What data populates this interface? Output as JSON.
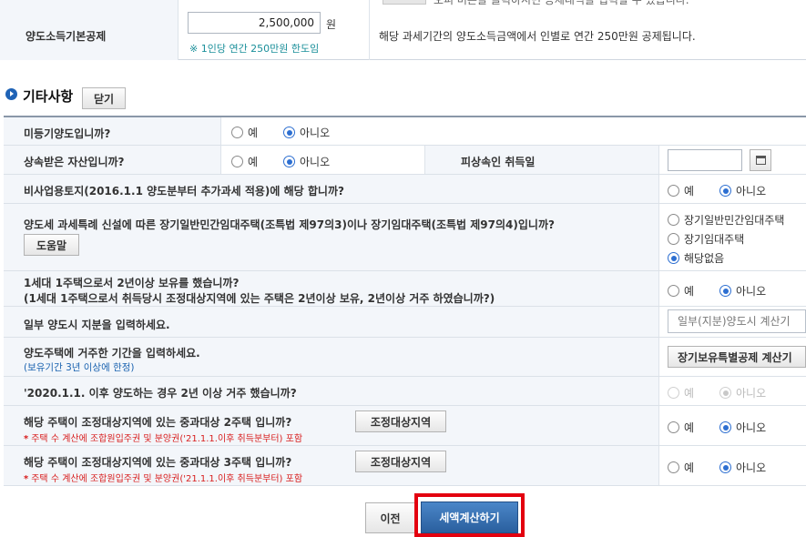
{
  "top_section": {
    "label": "양도소득기본공제",
    "amount_value": "2,500,000",
    "unit": "원",
    "limit_note": "※ 1인당 연간 250만원 한도임",
    "description": "해당 과세기간의 양도소득금액에서 인별로 연간 250만원 공제됩니다.",
    "cut_off_text": "오피 버튼을 클릭하시면 공제내역을 입력할 수 있습니다."
  },
  "section": {
    "title": "기타사항",
    "close_label": "닫기"
  },
  "rows": {
    "unregistered": {
      "question": "미등기양도입니까?",
      "yes": "예",
      "no": "아니오"
    },
    "inherited": {
      "question": "상속받은 자산입니까?",
      "yes": "예",
      "no": "아니오",
      "decedent_label": "피상속인 취득일"
    },
    "non_business_land": {
      "question": "비사업용토지(2016.1.1 양도분부터 추가과세 적용)에 해당 합니까?",
      "yes": "예",
      "no": "아니오"
    },
    "long_term_rental": {
      "question": "양도세 과세특례 신설에 따른 장기일반민간임대주택(조특법 제97의3)이나 장기임대주택(조특법 제97의4)입니까?",
      "help_label": "도움말",
      "options": [
        "장기일반민간임대주택",
        "장기임대주택",
        "해당없음"
      ]
    },
    "one_house": {
      "question_line1": "1세대 1주택으로서 2년이상 보유를 했습니까?",
      "question_line2": "(1세대 1주택으로서 취득당시 조정대상지역에 있는 주택은 2년이상 보유, 2년이상 거주 하였습니까?)",
      "yes": "예",
      "no": "아니오"
    },
    "partial_transfer": {
      "question": "일부 양도시 지분을 입력하세요.",
      "button_label": "일부(지분)양도시 계산기"
    },
    "residence_period": {
      "question": "양도주택에 거주한 기간을 입력하세요.",
      "note": "(보유기간 3년 이상에 한정)",
      "button_label": "장기보유특별공제 계산기"
    },
    "after_2020": {
      "question": "'2020.1.1. 이후 양도하는 경우 2년 이상 거주 했습니까?",
      "yes": "예",
      "no": "아니오"
    },
    "two_houses": {
      "question": "해당 주택이 조정대상지역에 있는 중과대상 2주택 입니까?",
      "button_label": "조정대상지역",
      "note": "주택 수 계산에 조합원입주권 및 분양권('21.1.1.이후 취득분부터) 포함",
      "yes": "예",
      "no": "아니오"
    },
    "three_houses": {
      "question": "해당 주택이 조정대상지역에 있는 중과대상 3주택 입니까?",
      "button_label": "조정대상지역",
      "note": "주택 수 계산에 조합원입주권 및 분양권('21.1.1.이후 취득분부터) 포함",
      "yes": "예",
      "no": "아니오"
    }
  },
  "footer": {
    "prev_label": "이전",
    "calc_label": "세액계산하기"
  },
  "colors": {
    "accent": "#2a5f9e",
    "highlight": "#e3000f",
    "note_blue": "#1b63b0",
    "note_red": "#d81e1e"
  }
}
